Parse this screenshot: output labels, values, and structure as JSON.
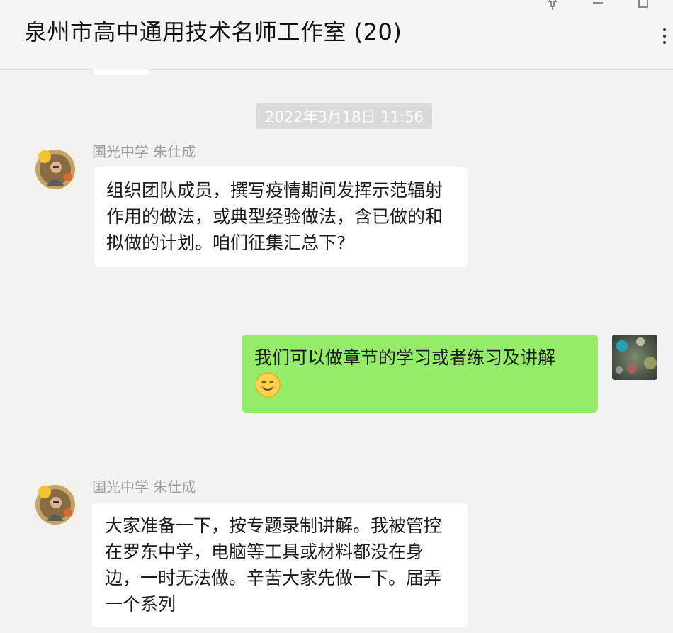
{
  "header": {
    "title": "泉州市高中通用技术名师工作室 (20)"
  },
  "timestamp": "2022年3月18日 11:56",
  "messages": [
    {
      "sender": "国光中学 朱仕成",
      "text": "组织团队成员，撰写疫情期间发挥示范辐射作用的做法，或典型经验做法，含已做的和拟做的计划。咱们征集汇总下?"
    },
    {
      "sender": "",
      "text": "我们可以做章节的学习或者练习及讲解",
      "emoji": "smiling-face-emoji"
    },
    {
      "sender": "国光中学 朱仕成",
      "text": "大家准备一下，按专题录制讲解。我被管控在罗东中学，电脑等工具或材料都没在身边，一时无法做。辛苦大家先做一下。届弄一个系列"
    }
  ],
  "colors": {
    "background": "#f2f2f2",
    "bubble_other": "#ffffff",
    "bubble_me": "#95ec69",
    "timestamp_bg": "#dadada",
    "sender_text": "#9a9a9a"
  },
  "icons": [
    "pin-icon",
    "minimize-icon",
    "maximize-icon",
    "more-icon"
  ]
}
